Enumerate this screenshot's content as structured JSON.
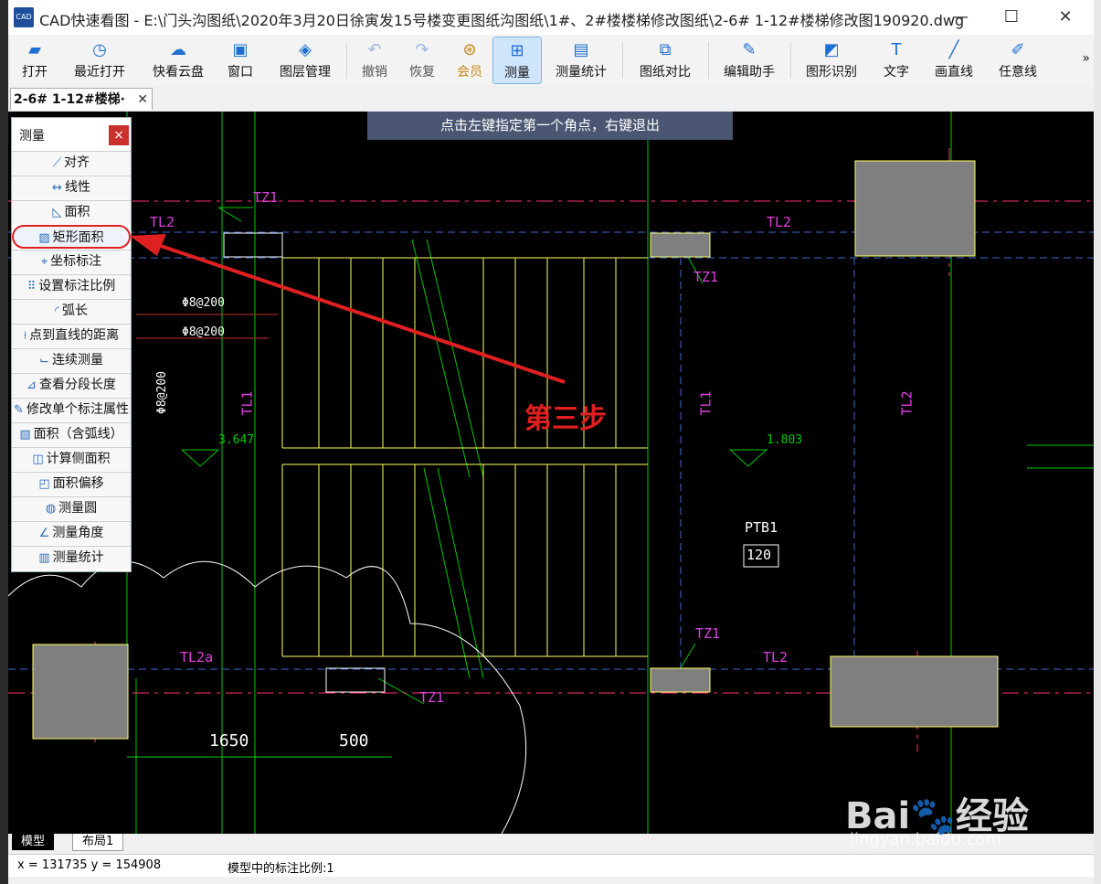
{
  "window": {
    "title": "CAD快速看图 - E:\\门头沟图纸\\2020年3月20日徐寅发15号楼变更图纸沟图纸\\1#、2#楼楼梯修改图纸\\2-6# 1-12#楼梯修改图190920.dwg",
    "app_icon_text": "CAD",
    "minimize": "—",
    "maximize": "☐",
    "close": "✕"
  },
  "toolbar": {
    "items": [
      {
        "label": "打开",
        "icon": "folder-icon"
      },
      {
        "label": "最近打开",
        "icon": "clock-icon"
      },
      {
        "label": "快看云盘",
        "icon": "cloud-icon"
      },
      {
        "label": "窗口",
        "icon": "window-icon"
      },
      {
        "label": "图层管理",
        "icon": "layers-icon"
      },
      {
        "label": "撤销",
        "icon": "undo-icon"
      },
      {
        "label": "恢复",
        "icon": "redo-icon"
      },
      {
        "label": "会员",
        "icon": "vip-icon"
      },
      {
        "label": "测量",
        "icon": "ruler-icon"
      },
      {
        "label": "测量统计",
        "icon": "stats-icon"
      },
      {
        "label": "图纸对比",
        "icon": "compare-icon"
      },
      {
        "label": "编辑助手",
        "icon": "edit-assistant-icon"
      },
      {
        "label": "图形识别",
        "icon": "recognize-icon"
      },
      {
        "label": "文字",
        "icon": "text-icon"
      },
      {
        "label": "画直线",
        "icon": "line-icon"
      },
      {
        "label": "任意线",
        "icon": "freehand-icon"
      }
    ],
    "more": "»"
  },
  "doc_tab": {
    "label": "2-6# 1-12#楼梯·",
    "close": "✕"
  },
  "hint": "点击左键指定第一个角点，右键退出",
  "measure_panel": {
    "title": "测量",
    "close": "×",
    "items": [
      "对齐",
      "线性",
      "面积",
      "矩形面积",
      "坐标标注",
      "设置标注比例",
      "弧长",
      "点到直线的距离",
      "连续测量",
      "查看分段长度",
      "修改单个标注属性",
      "面积（含弧线）",
      "计算侧面积",
      "面积偏移",
      "测量圆",
      "测量角度",
      "测量统计"
    ]
  },
  "annotation": "第三步",
  "drawing": {
    "labels": {
      "tz1_a": "TZ1",
      "tz1_b": "TZ1",
      "tz1_c": "TZ1",
      "tz1_d": "TZ1",
      "tl2_a": "TL2",
      "tl2_b": "TL2",
      "tl2_c": "TL2",
      "tl2a": "TL2a",
      "tl1_a": "TL1",
      "tl1_b": "TL1",
      "tl2_v": "TL2",
      "rebar_1": "Φ8@200",
      "rebar_2": "Φ8@200",
      "rebar_v": "Φ8@200",
      "elev_1": "3.647",
      "elev_2": "1.803",
      "ptb1": "PTB1",
      "ptb1_val": "120",
      "dim_1": "1650",
      "dim_2": "500"
    }
  },
  "layout_tabs": {
    "model": "模型",
    "layout1": "布局1"
  },
  "status": {
    "coords": "x = 131735  y = 154908",
    "scale": "模型中的标注比例:1"
  },
  "watermark": {
    "brand": "Bai",
    "brand_cn": "经验",
    "url": "jingyan.baidu.com"
  }
}
